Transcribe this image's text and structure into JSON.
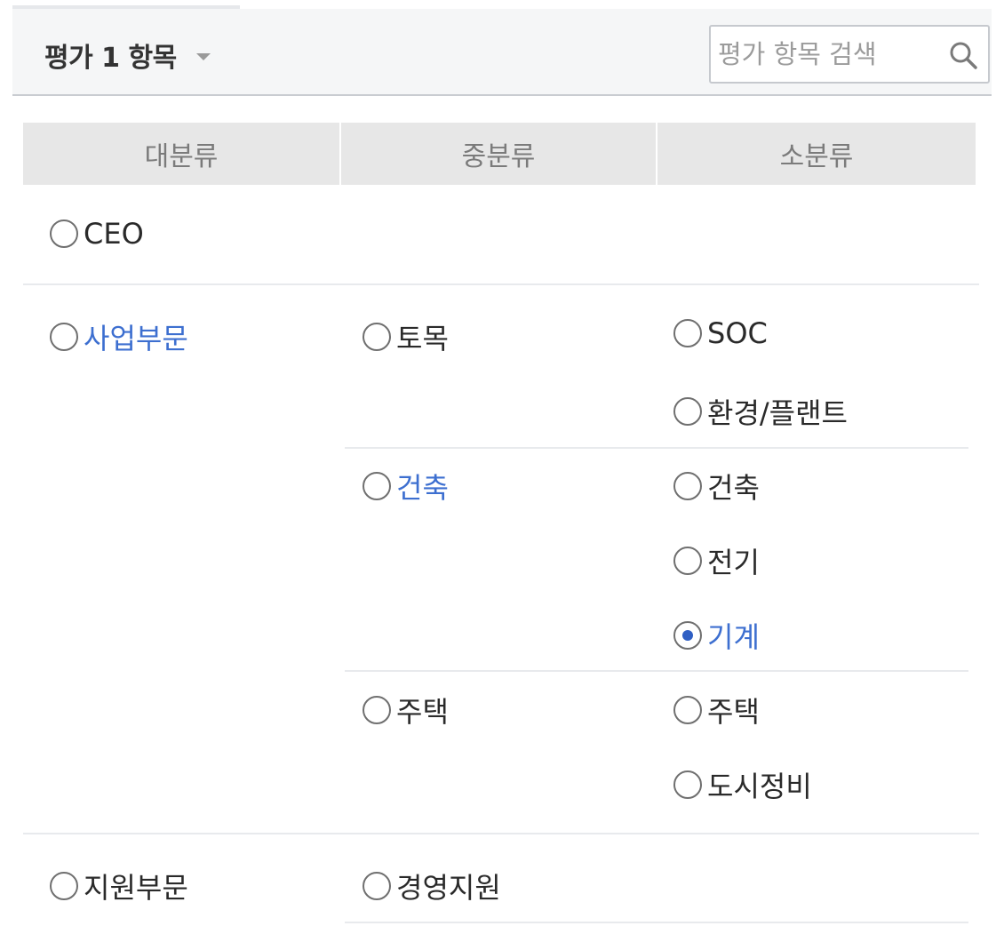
{
  "header": {
    "title": "평가 1 항목",
    "search_placeholder": "평가 항목 검색"
  },
  "table": {
    "columns": [
      "대분류",
      "중분류",
      "소분류"
    ]
  },
  "categories": {
    "ceo": {
      "label": "CEO"
    },
    "business": {
      "label": "사업부문",
      "civil": {
        "label": "토목",
        "soc": "SOC",
        "env_plant": "환경/플랜트"
      },
      "architecture": {
        "label": "건축",
        "arch": "건축",
        "electric": "전기",
        "mechanical": "기계"
      },
      "housing": {
        "label": "주택",
        "housing": "주택",
        "urban": "도시정비"
      }
    },
    "support": {
      "label": "지원부문",
      "management": {
        "label": "경영지원"
      }
    }
  },
  "selected": "기계",
  "colors": {
    "highlight_text": "#3d6fd0",
    "radio_checked": "#2f5fc4",
    "header_bg": "#f5f6f7",
    "column_header_bg": "#e7e7e7"
  }
}
